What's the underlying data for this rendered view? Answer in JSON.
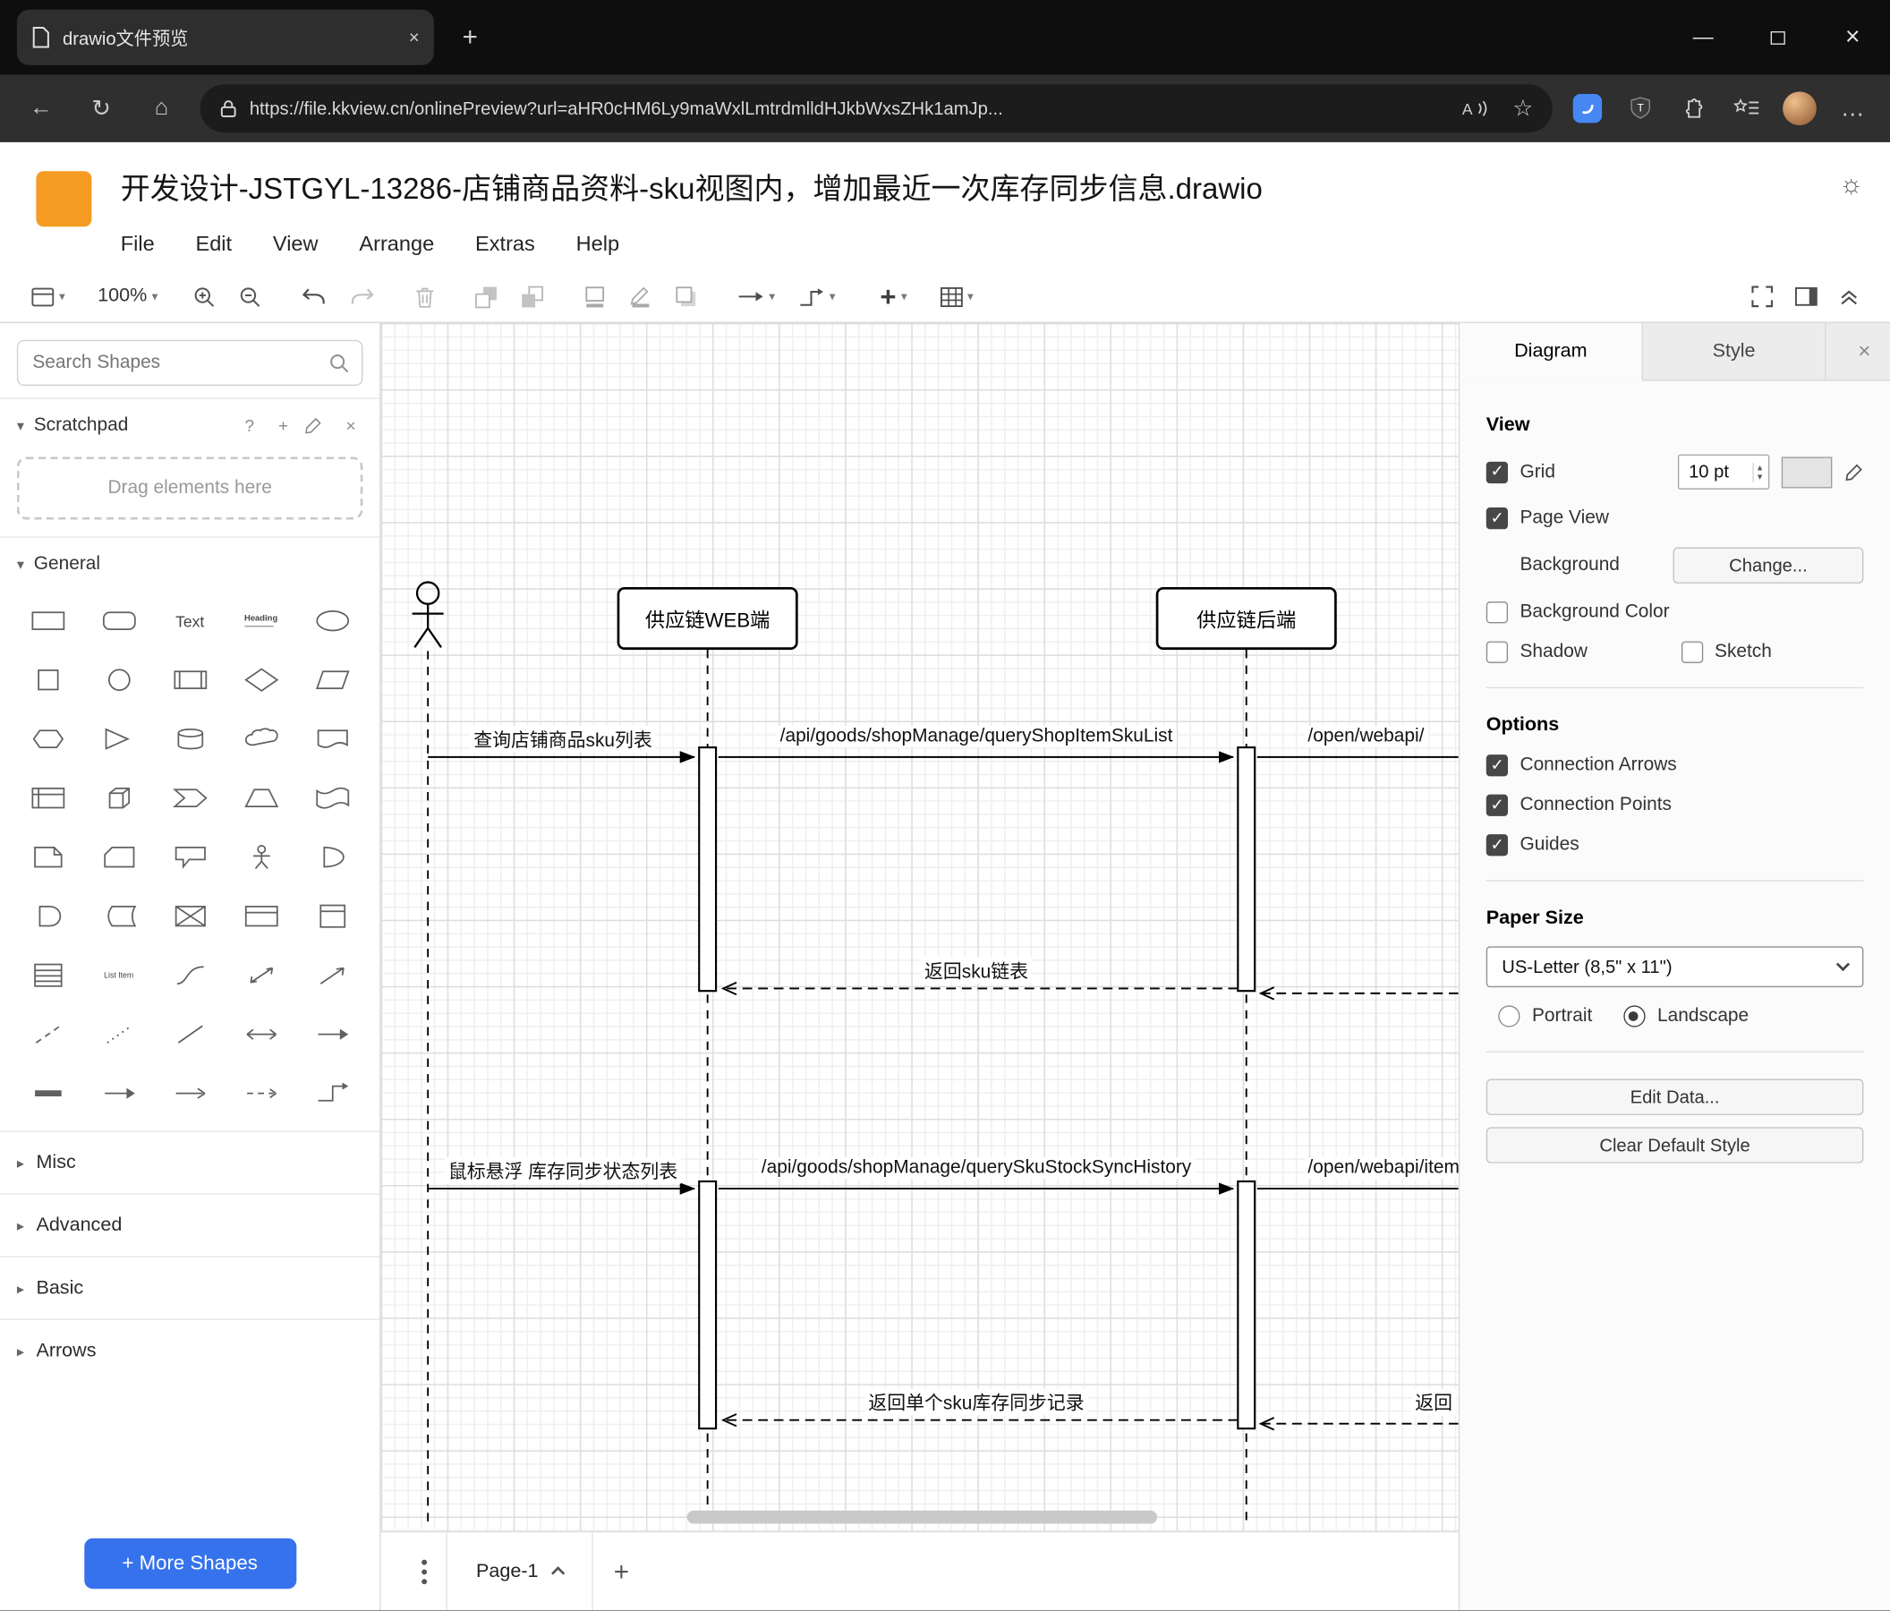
{
  "icons": {
    "back": "←",
    "refresh": "↻",
    "home": "⌂",
    "bookmark_star": "☆",
    "more": "…",
    "caret_down": "▾",
    "caret_right": "▸",
    "caret_up": "▴",
    "check": "✓",
    "sun": "☼",
    "plus": "+",
    "close": "×",
    "minimize": "—",
    "help": "?",
    "read_aloud": "A"
  },
  "browser": {
    "tab_title": "drawio文件预览",
    "url": "https://file.kkview.cn/onlinePreview?url=aHR0cHM6Ly9maWxlLmtrdmlldHJkbWxsZHk1amJp..."
  },
  "app": {
    "title": "开发设计-JSTGYL-13286-店铺商品资料-sku视图内，增加最近一次库存同步信息.drawio",
    "menus": [
      "File",
      "Edit",
      "View",
      "Arrange",
      "Extras",
      "Help"
    ],
    "zoom": "100%"
  },
  "shapes_panel": {
    "search_placeholder": "Search Shapes",
    "scratchpad_title": "Scratchpad",
    "drag_hint": "Drag elements here",
    "general_label": "General",
    "text_shape_label": "Text",
    "heading_shape_label": "Heading",
    "list_item_label": "List Item",
    "sections": [
      "Misc",
      "Advanced",
      "Basic",
      "Arrows"
    ],
    "more_shapes": "+ More Shapes",
    "general_shapes": [
      "rectangle",
      "rounded-rectangle",
      "text",
      "heading",
      "ellipse",
      "square",
      "circle",
      "process",
      "diamond",
      "parallelogram",
      "hexagon",
      "triangle",
      "cylinder",
      "cloud",
      "document",
      "internal-storage",
      "cube",
      "step",
      "trapezoid",
      "tape",
      "note",
      "card",
      "callout",
      "actor",
      "or",
      "and",
      "data-storage",
      "switch",
      "container",
      "vertical-container",
      "list",
      "list-item",
      "curve",
      "bidirectional-arrow",
      "arrow",
      "dashed-line",
      "dotted-line",
      "line",
      "bidirectional-connector",
      "directional-connector",
      "link",
      "arrow-right",
      "simple-arrow",
      "dashed-edge",
      "elbow"
    ]
  },
  "diagram": {
    "participants": [
      {
        "label": "供应链WEB端"
      },
      {
        "label": "供应链后端"
      }
    ],
    "messages": [
      {
        "label": "查询店铺商品sku列表",
        "type": "request"
      },
      {
        "label": "/api/goods/shopManage/queryShopItemSkuList",
        "type": "request"
      },
      {
        "label": "/open/webapi/",
        "type": "request"
      },
      {
        "label": "返回sku链表",
        "type": "return"
      },
      {
        "label": "鼠标悬浮 库存同步状态列表",
        "type": "request"
      },
      {
        "label": "/api/goods/shopManage/querySkuStockSyncHistory",
        "type": "request"
      },
      {
        "label": "/open/webapi/item",
        "type": "request"
      },
      {
        "label": "返回单个sku库存同步记录",
        "type": "return"
      },
      {
        "label": "返回",
        "type": "return"
      }
    ]
  },
  "pagebar": {
    "page": "Page-1"
  },
  "format_panel": {
    "tabs": [
      {
        "label": "Diagram",
        "active": true
      },
      {
        "label": "Style",
        "active": false
      }
    ],
    "view_title": "View",
    "view": {
      "grid": {
        "label": "Grid",
        "checked": true,
        "size": "10 pt"
      },
      "page_view": {
        "label": "Page View",
        "checked": true
      },
      "background_label": "Background",
      "change_button": "Change...",
      "background_color": {
        "label": "Background Color",
        "checked": false
      },
      "shadow": {
        "label": "Shadow",
        "checked": false
      },
      "sketch": {
        "label": "Sketch",
        "checked": false
      }
    },
    "options_title": "Options",
    "options": [
      {
        "label": "Connection Arrows",
        "checked": true
      },
      {
        "label": "Connection Points",
        "checked": true
      },
      {
        "label": "Guides",
        "checked": true
      }
    ],
    "paper": {
      "title": "Paper Size",
      "size": "US-Letter (8,5\" x 11\")",
      "portrait": "Portrait",
      "landscape": "Landscape",
      "orientation": "landscape"
    },
    "edit_data": "Edit Data...",
    "clear_default": "Clear Default Style"
  }
}
